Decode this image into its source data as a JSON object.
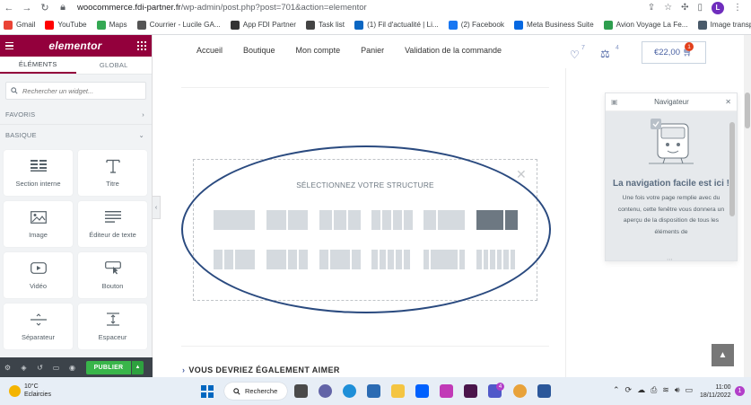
{
  "browser": {
    "url_host": "woocommerce.fdi-partner.fr",
    "url_path": "/wp-admin/post.php?post=701&action=elementor",
    "profile_initial": "L"
  },
  "bookmarks": [
    {
      "label": "Gmail",
      "color": "#ea4335"
    },
    {
      "label": "YouTube",
      "color": "#ff0000"
    },
    {
      "label": "Maps",
      "color": "#34a853"
    },
    {
      "label": "Courrier - Lucile GA...",
      "color": "#555555"
    },
    {
      "label": "App FDI Partner",
      "color": "#333333"
    },
    {
      "label": "Task list",
      "color": "#444444"
    },
    {
      "label": "(1) Fil d'actualité | Li...",
      "color": "#0a66c2"
    },
    {
      "label": "(2) Facebook",
      "color": "#1877f2"
    },
    {
      "label": "Meta Business Suite",
      "color": "#0668e1"
    },
    {
      "label": "Avion Voyage La Fe...",
      "color": "#2e9e4f"
    },
    {
      "label": "Image transparente...",
      "color": "#4a5a6a"
    }
  ],
  "panel": {
    "logo": "elementor",
    "tabs": [
      "ÉLÉMENTS",
      "GLOBAL"
    ],
    "search_placeholder": "Rechercher un widget...",
    "categories": {
      "favoris": "FAVORIS",
      "basique": "BASIQUE"
    },
    "widgets": [
      {
        "label": "Section interne",
        "icon": "inner-section-icon"
      },
      {
        "label": "Titre",
        "icon": "heading-icon"
      },
      {
        "label": "Image",
        "icon": "image-icon"
      },
      {
        "label": "Éditeur de texte",
        "icon": "text-editor-icon"
      },
      {
        "label": "Vidéo",
        "icon": "video-icon"
      },
      {
        "label": "Bouton",
        "icon": "button-icon"
      },
      {
        "label": "Séparateur",
        "icon": "divider-icon"
      },
      {
        "label": "Espaceur",
        "icon": "spacer-icon"
      }
    ],
    "publish_label": "PUBLIER"
  },
  "site": {
    "nav": [
      "Accueil",
      "Boutique",
      "Mon compte",
      "Panier",
      "Validation de la commande"
    ],
    "wishlist_count": "7",
    "compare_count": "4",
    "cart_total": "€22,00",
    "cart_count": "1",
    "structure_title": "SÉLECTIONNEZ VOTRE STRUCTURE",
    "also_like": "VOUS DEVRIEZ ÉGALEMENT AIMER"
  },
  "navigator": {
    "title": "Navigateur",
    "headline": "La navigation facile est ici !",
    "description": "Une fois votre page remplie avec du contenu, cette fenêtre vous donnera un aperçu de la disposition de tous les éléments de"
  },
  "taskbar": {
    "temperature": "10°C",
    "weather": "Eclaircies",
    "search_label": "Recherche",
    "teams_badge": "4",
    "time": "11:00",
    "date": "18/11/2022",
    "notifications": "1"
  }
}
